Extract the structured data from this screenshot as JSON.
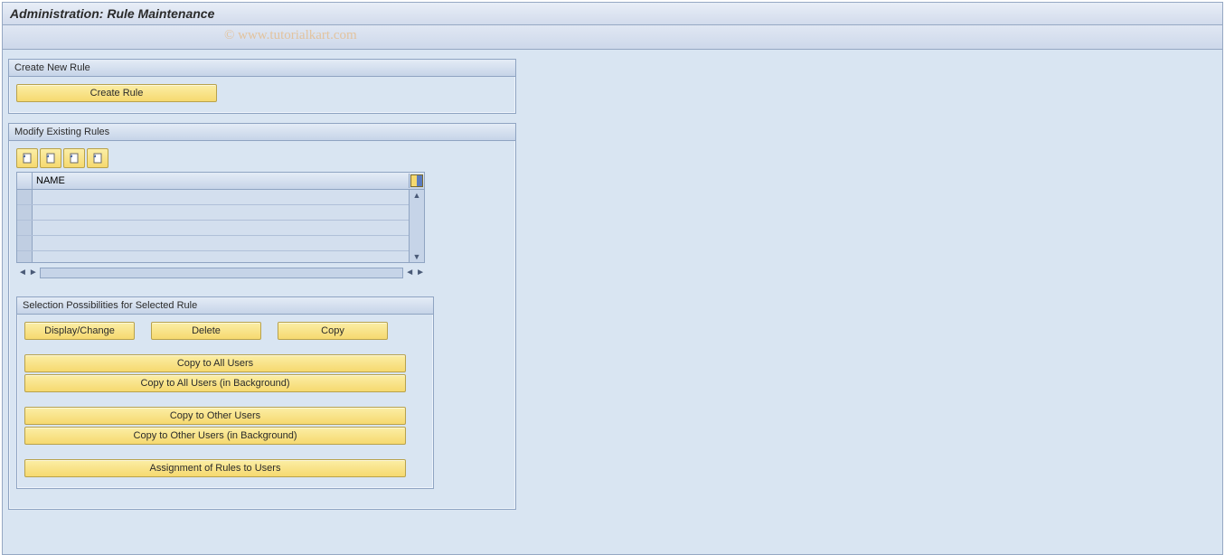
{
  "header": {
    "title": "Administration: Rule Maintenance"
  },
  "watermark": "© www.tutorialkart.com",
  "panels": {
    "create": {
      "title": "Create New Rule",
      "create_rule": "Create Rule"
    },
    "modify": {
      "title": "Modify Existing Rules",
      "columns": {
        "name": "NAME"
      },
      "rows": [
        "",
        "",
        "",
        "",
        ""
      ]
    },
    "selection": {
      "title": "Selection Possibilities for Selected Rule",
      "display_change": "Display/Change",
      "delete": "Delete",
      "copy": "Copy",
      "copy_all": "Copy to All Users",
      "copy_all_bg": "Copy to All Users (in Background)",
      "copy_other": "Copy to Other Users",
      "copy_other_bg": "Copy to Other Users (in Background)",
      "assignment": "Assignment of Rules to Users"
    }
  },
  "icons": {
    "toolbar": [
      "doc-a",
      "doc-b",
      "doc-c",
      "doc-d"
    ]
  }
}
